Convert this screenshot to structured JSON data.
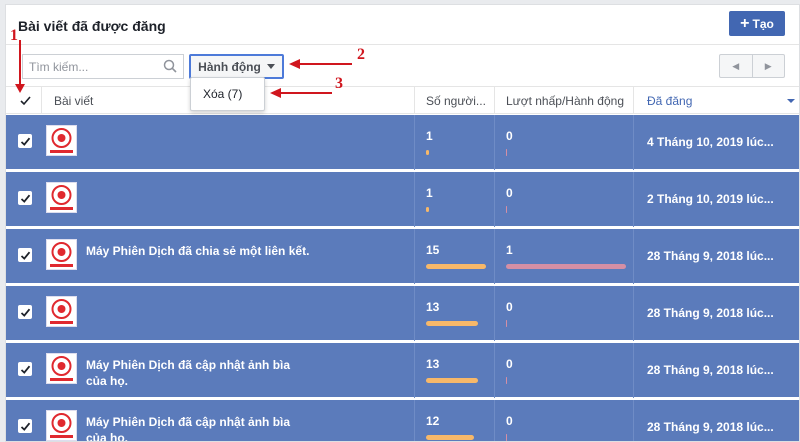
{
  "page": {
    "title": "Bài viết đã được đăng",
    "create_button": "Tạo"
  },
  "toolbar": {
    "search_placeholder": "Tìm kiếm...",
    "action_label": "Hành động",
    "action_menu_items": [
      "Xóa (7)"
    ]
  },
  "table": {
    "columns": [
      "Bài viết",
      "Số người...",
      "Lượt nhấp/Hành động",
      "Đã đăng"
    ],
    "rows": [
      {
        "post": "",
        "reach": "1",
        "reach_fraction": 0.05,
        "clicks": "0",
        "clicks_fraction": 0.0,
        "date": "4 Tháng 10, 2019 lúc..."
      },
      {
        "post": "",
        "reach": "1",
        "reach_fraction": 0.05,
        "clicks": "0",
        "clicks_fraction": 0.0,
        "date": "2 Tháng 10, 2019 lúc..."
      },
      {
        "post": "Máy Phiên Dịch đã chia sẻ một liên kết.",
        "reach": "15",
        "reach_fraction": 1.0,
        "clicks": "1",
        "clicks_fraction": 1.0,
        "date": "28 Tháng 9, 2018 lúc..."
      },
      {
        "post": "",
        "reach": "13",
        "reach_fraction": 0.87,
        "clicks": "0",
        "clicks_fraction": 0.0,
        "date": "28 Tháng 9, 2018 lúc..."
      },
      {
        "post": "Máy Phiên Dịch đã cập nhật ảnh bìa của họ.",
        "reach": "13",
        "reach_fraction": 0.87,
        "clicks": "0",
        "clicks_fraction": 0.0,
        "date": "28 Tháng 9, 2018 lúc..."
      },
      {
        "post": "Máy Phiên Dịch đã cập nhật ảnh bìa của họ.",
        "reach": "12",
        "reach_fraction": 0.8,
        "clicks": "0",
        "clicks_fraction": 0.0,
        "date": "28 Tháng 9, 2018 lúc..."
      }
    ]
  },
  "annotations": [
    "1",
    "2",
    "3"
  ],
  "colors": {
    "accent": "#4267b2",
    "selected_row": "#5b7bbb",
    "reach_bar": "#f7b869",
    "clicks_bar": "#d48fa5",
    "annotation": "#d0161e"
  }
}
